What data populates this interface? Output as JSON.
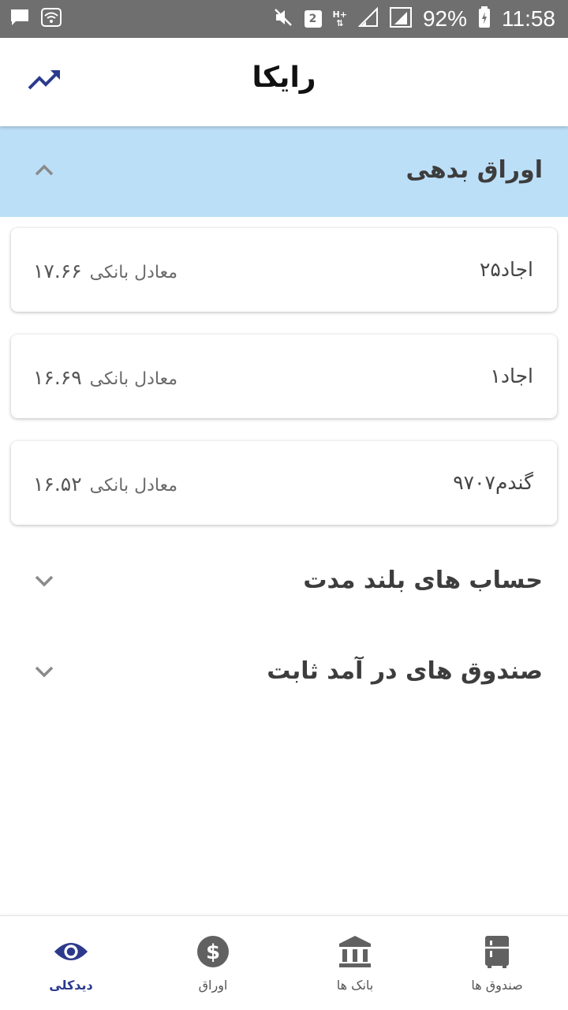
{
  "status_bar": {
    "battery": "92%",
    "time": "11:58",
    "sim_slot": "2",
    "network": "H+",
    "icons": [
      "chat-icon",
      "wifi-icon",
      "mute-icon",
      "sim-icon",
      "signal-icon",
      "battery-icon"
    ]
  },
  "app_bar": {
    "title": "رایکا",
    "trend_icon": "trending-up-icon",
    "accent_color": "#2b3a8c"
  },
  "sections": [
    {
      "title": "اوراق بدهی",
      "expanded": true,
      "items": [
        {
          "name": "اجاد۲۵",
          "equivalent_label": "معادل بانکی",
          "equivalent_value": "۱۷.۶۶"
        },
        {
          "name": "اجاد۱",
          "equivalent_label": "معادل بانکی",
          "equivalent_value": "۱۶.۶۹"
        },
        {
          "name": "گندم۹۷۰۷",
          "equivalent_label": "معادل بانکی",
          "equivalent_value": "۱۶.۵۲"
        }
      ]
    },
    {
      "title": "حساب های بلند مدت",
      "expanded": false
    },
    {
      "title": "صندوق های در آمد ثابت",
      "expanded": false
    }
  ],
  "bottom_nav": [
    {
      "label": "صندوق ها",
      "icon": "fund-icon",
      "active": false
    },
    {
      "label": "بانک ها",
      "icon": "bank-icon",
      "active": false
    },
    {
      "label": "اوراق",
      "icon": "dollar-icon",
      "active": false
    },
    {
      "label": "دیدکلی",
      "icon": "eye-icon",
      "active": true
    }
  ],
  "colors": {
    "status_bar": "#6f6f6f",
    "section_highlight": "#bcdff8",
    "active_nav": "#2b3a8c",
    "inactive_nav": "#616161"
  }
}
